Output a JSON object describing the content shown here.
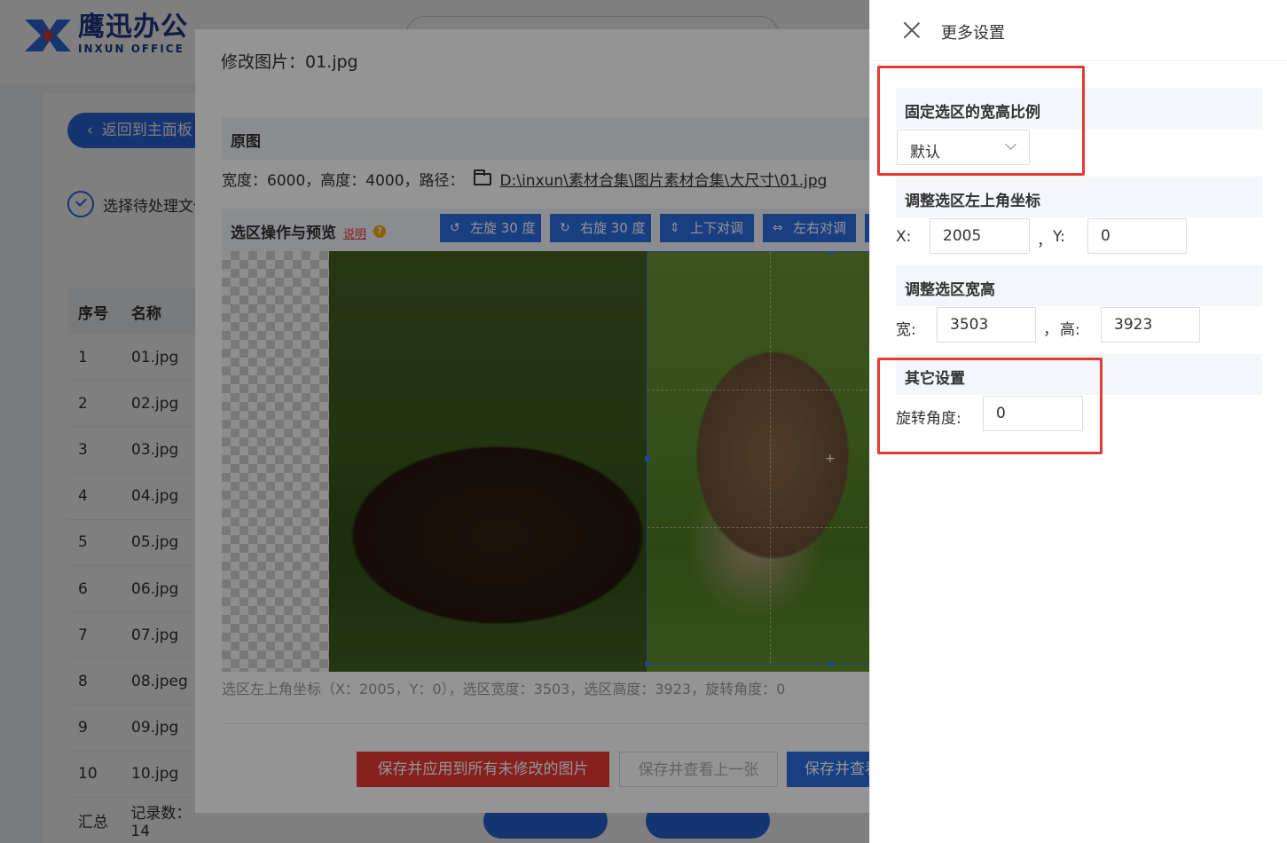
{
  "app": {
    "logo_cn": "鹰迅办公",
    "logo_en": "INXUN OFFICE",
    "back_label": "返回到主面板",
    "step_label": "选择待处理文件",
    "table": {
      "headers": [
        "序号",
        "名称"
      ],
      "rows": [
        {
          "idx": "1",
          "name": "01.jpg"
        },
        {
          "idx": "2",
          "name": "02.jpg"
        },
        {
          "idx": "3",
          "name": "03.jpg"
        },
        {
          "idx": "4",
          "name": "04.jpg"
        },
        {
          "idx": "5",
          "name": "05.jpg"
        },
        {
          "idx": "6",
          "name": "06.jpg"
        },
        {
          "idx": "7",
          "name": "07.jpg"
        },
        {
          "idx": "8",
          "name": "08.jpeg"
        },
        {
          "idx": "9",
          "name": "09.jpg"
        },
        {
          "idx": "10",
          "name": "10.jpg"
        }
      ],
      "footer_label": "汇总",
      "footer_count": "记录数：14"
    }
  },
  "modal": {
    "title": "修改图片：01.jpg",
    "original_section": "原图",
    "original_info": "宽度：6000，高度：4000，路径：",
    "original_path": "D:\\inxun\\素材合集\\图片素材合集\\大尺寸\\01.jpg",
    "selection_section": "选区操作与预览",
    "help_label": "说明",
    "tools": [
      {
        "icon": "rotate-left-icon",
        "glyph": "↺",
        "label": "左旋 30 度"
      },
      {
        "icon": "rotate-right-icon",
        "glyph": "↻",
        "label": "右旋 30 度"
      },
      {
        "icon": "flip-vertical-icon",
        "glyph": "⇕",
        "label": "上下对调"
      },
      {
        "icon": "flip-horizontal-icon",
        "glyph": "⇔",
        "label": "左右对调"
      }
    ],
    "status": "选区左上角坐标（X：2005，Y：0），选区宽度：3503，选区高度：3923，旋转角度：0",
    "save_all_label": "保存并应用到所有未修改的图片",
    "prev_label": "保存并查看上一张",
    "next_label": "保存并查看下一张"
  },
  "panel": {
    "title": "更多设置",
    "ratio_section": "固定选区的宽高比例",
    "ratio_value": "默认",
    "coord_section": "调整选区左上角坐标",
    "x_label": "X:",
    "x_value": "2005",
    "sep": "，",
    "y_label": "Y:",
    "y_value": "0",
    "size_section": "调整选区宽高",
    "w_label": "宽:",
    "w_value": "3503",
    "h_label": "高:",
    "h_value": "3923",
    "other_section": "其它设置",
    "rotate_label": "旋转角度:",
    "rotate_value": "0"
  },
  "colors": {
    "primary": "#2c6be0",
    "danger": "#e53935",
    "highlight_box": "#e53935"
  }
}
